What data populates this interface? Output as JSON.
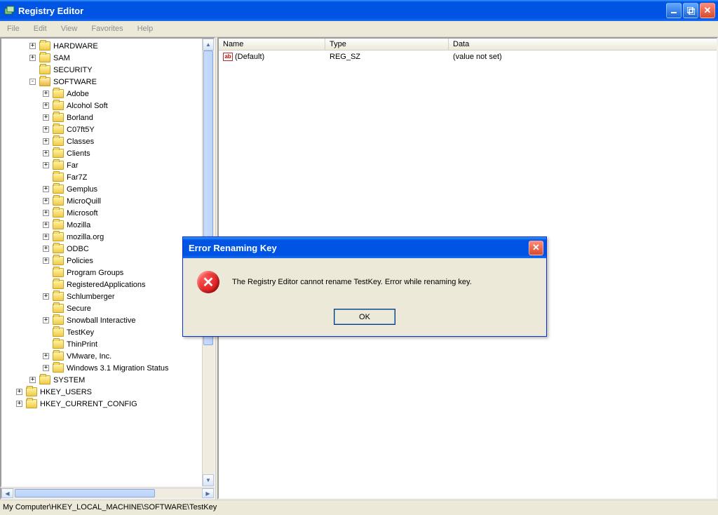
{
  "window": {
    "title": "Registry Editor"
  },
  "menu": {
    "file": "File",
    "edit": "Edit",
    "view": "View",
    "favorites": "Favorites",
    "help": "Help"
  },
  "tree": {
    "items": [
      {
        "indent": 2,
        "expander": "+",
        "label": "HARDWARE"
      },
      {
        "indent": 2,
        "expander": "+",
        "label": "SAM"
      },
      {
        "indent": 2,
        "expander": "",
        "label": "SECURITY"
      },
      {
        "indent": 2,
        "expander": "-",
        "label": "SOFTWARE",
        "open": true
      },
      {
        "indent": 3,
        "expander": "+",
        "label": "Adobe"
      },
      {
        "indent": 3,
        "expander": "+",
        "label": "Alcohol Soft"
      },
      {
        "indent": 3,
        "expander": "+",
        "label": "Borland"
      },
      {
        "indent": 3,
        "expander": "+",
        "label": "C07ft5Y"
      },
      {
        "indent": 3,
        "expander": "+",
        "label": "Classes"
      },
      {
        "indent": 3,
        "expander": "+",
        "label": "Clients"
      },
      {
        "indent": 3,
        "expander": "+",
        "label": "Far"
      },
      {
        "indent": 3,
        "expander": "",
        "label": "Far7Z"
      },
      {
        "indent": 3,
        "expander": "+",
        "label": "Gemplus"
      },
      {
        "indent": 3,
        "expander": "+",
        "label": "MicroQuill"
      },
      {
        "indent": 3,
        "expander": "+",
        "label": "Microsoft"
      },
      {
        "indent": 3,
        "expander": "+",
        "label": "Mozilla"
      },
      {
        "indent": 3,
        "expander": "+",
        "label": "mozilla.org"
      },
      {
        "indent": 3,
        "expander": "+",
        "label": "ODBC"
      },
      {
        "indent": 3,
        "expander": "+",
        "label": "Policies"
      },
      {
        "indent": 3,
        "expander": "",
        "label": "Program Groups"
      },
      {
        "indent": 3,
        "expander": "",
        "label": "RegisteredApplications"
      },
      {
        "indent": 3,
        "expander": "+",
        "label": "Schlumberger"
      },
      {
        "indent": 3,
        "expander": "",
        "label": "Secure"
      },
      {
        "indent": 3,
        "expander": "+",
        "label": "Snowball Interactive"
      },
      {
        "indent": 3,
        "expander": "",
        "label": "TestKey"
      },
      {
        "indent": 3,
        "expander": "",
        "label": "ThinPrint"
      },
      {
        "indent": 3,
        "expander": "+",
        "label": "VMware, Inc."
      },
      {
        "indent": 3,
        "expander": "+",
        "label": "Windows 3.1 Migration Status"
      },
      {
        "indent": 2,
        "expander": "+",
        "label": "SYSTEM"
      },
      {
        "indent": 1,
        "expander": "+",
        "label": "HKEY_USERS"
      },
      {
        "indent": 1,
        "expander": "+",
        "label": "HKEY_CURRENT_CONFIG"
      }
    ]
  },
  "list": {
    "columns": {
      "name": "Name",
      "type": "Type",
      "data": "Data"
    },
    "row": {
      "name": "(Default)",
      "type": "REG_SZ",
      "data": "(value not set)"
    }
  },
  "status": {
    "path": "My Computer\\HKEY_LOCAL_MACHINE\\SOFTWARE\\TestKey"
  },
  "dialog": {
    "title": "Error Renaming Key",
    "message": "The Registry Editor cannot rename TestKey. Error while renaming key.",
    "ok": "OK"
  }
}
